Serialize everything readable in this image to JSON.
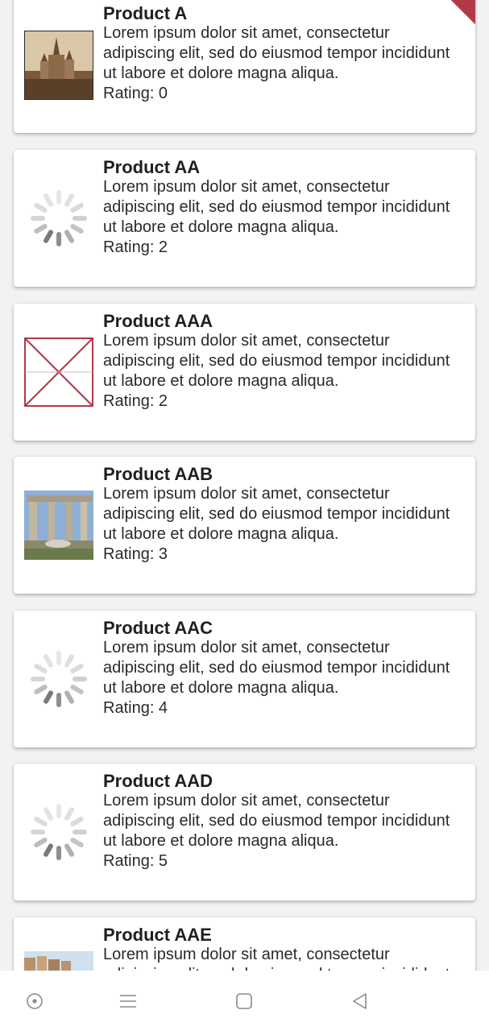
{
  "products": [
    {
      "title": "Product A",
      "description": "Lorem ipsum dolor sit amet, consectetur adipiscing elit, sed do eiusmod tempor incididunt ut labore et dolore magna aliqua.",
      "rating": "Rating: 0",
      "image_state": "castle-photo"
    },
    {
      "title": "Product AA",
      "description": "Lorem ipsum dolor sit amet, consectetur adipiscing elit, sed do eiusmod tempor incididunt ut labore et dolore magna aliqua.",
      "rating": "Rating: 2",
      "image_state": "loading-spinner"
    },
    {
      "title": "Product AAA",
      "description": "Lorem ipsum dolor sit amet, consectetur adipiscing elit, sed do eiusmod tempor incididunt ut labore et dolore magna aliqua.",
      "rating": "Rating: 2",
      "image_state": "broken-image"
    },
    {
      "title": "Product AAB",
      "description": "Lorem ipsum dolor sit amet, consectetur adipiscing elit, sed do eiusmod tempor incididunt ut labore et dolore magna aliqua.",
      "rating": "Rating: 3",
      "image_state": "ruins-photo"
    },
    {
      "title": "Product AAC",
      "description": "Lorem ipsum dolor sit amet, consectetur adipiscing elit, sed do eiusmod tempor incididunt ut labore et dolore magna aliqua.",
      "rating": "Rating: 4",
      "image_state": "loading-spinner"
    },
    {
      "title": "Product AAD",
      "description": "Lorem ipsum dolor sit amet, consectetur adipiscing elit, sed do eiusmod tempor incididunt ut labore et dolore magna aliqua.",
      "rating": "Rating: 5",
      "image_state": "loading-spinner"
    },
    {
      "title": "Product AAE",
      "description": "Lorem ipsum dolor sit amet, consectetur adipiscing elit, sed do eiusmod tempor incididunt ut labore et dolore magna aliqua.",
      "rating": "",
      "image_state": "buildings-photo"
    }
  ],
  "colors": {
    "card_bg": "#ffffff",
    "page_bg": "#f2f2f2",
    "broken_image_accent": "#b03a48",
    "spinner": "#9e9e9e",
    "ribbon": "#b03a48"
  },
  "navbar": {
    "icons": [
      "assistant-circle-icon",
      "menu-lines-icon",
      "home-square-icon",
      "back-triangle-icon"
    ]
  }
}
